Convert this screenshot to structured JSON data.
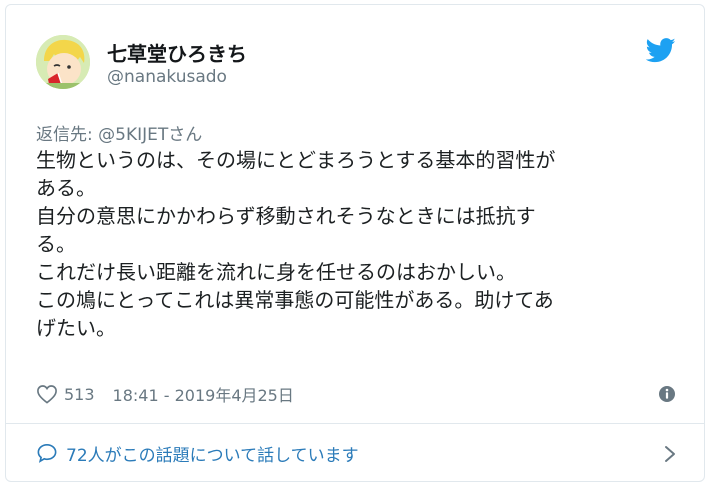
{
  "author": {
    "name": "七草堂ひろきち",
    "handle": "@nanakusado"
  },
  "reply": {
    "prefix": "返信先: ",
    "mention": "@5KIJET",
    "suffix": "さん"
  },
  "tweet": {
    "lines": [
      "生物というのは、その場にとどまろうとする基本的習性が",
      "ある。",
      "自分の意思にかかわらず移動されそうなときには抵抗す",
      "る。",
      "これだけ長い距離を流れに身を任せるのはおかしい。",
      "この鳩にとってこれは異常事態の可能性がある。助けてあ",
      "げたい。"
    ]
  },
  "meta": {
    "likes": "513",
    "timestamp": "18:41 - 2019年4月25日"
  },
  "footer": {
    "conversation_label": "72人がこの話題について話しています"
  },
  "colors": {
    "brand_blue": "#1da1f2",
    "link_blue": "#2b7bb9",
    "muted": "#697882",
    "text": "#1c2022",
    "border": "#e1e8ed"
  },
  "icons": {
    "brand": "twitter-bird-icon",
    "like": "heart-icon",
    "info": "info-icon",
    "conversation": "speech-bubble-icon",
    "more": "chevron-right-icon"
  }
}
